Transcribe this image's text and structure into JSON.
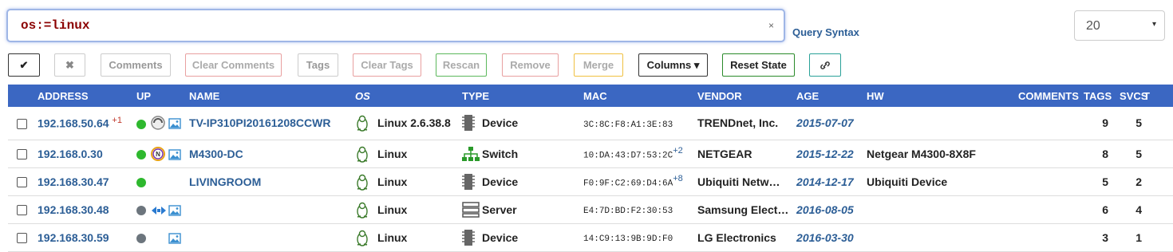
{
  "search": {
    "value": "os:=linux",
    "clear_label": "×"
  },
  "query_syntax_label": "Query Syntax",
  "page_size": {
    "value": "20",
    "caret": "▾"
  },
  "toolbar": {
    "check_label": "✔",
    "x_label": "✖",
    "comments": "Comments",
    "clear_comments": "Clear Comments",
    "tags": "Tags",
    "clear_tags": "Clear Tags",
    "rescan": "Rescan",
    "remove": "Remove",
    "merge": "Merge",
    "columns": "Columns ▾",
    "reset_state": "Reset State",
    "link_label": "🔗"
  },
  "headers": {
    "address": "ADDRESS",
    "up": "UP",
    "name": "NAME",
    "os": "OS",
    "type": "TYPE",
    "mac": "MAC",
    "vendor": "VENDOR",
    "age": "AGE",
    "hw": "HW",
    "comments": "COMMENTS",
    "tags": "TAGS",
    "svcs": "SVCS",
    "t": "T"
  },
  "rows": [
    {
      "address": "192.168.50.64",
      "addr_extra": "+1",
      "up": "#2eb82e",
      "name": "TV-IP310PI20161208CCWR",
      "os": "Linux 2.6.38.8",
      "type": "Device",
      "type_icon": "chip-icon",
      "mac": "3C:8C:F8:A1:3E:83",
      "mac_extra": "",
      "vendor": "TRENDnet, Inc.",
      "age": "2015-07-07",
      "hw": "",
      "tags": "9",
      "svcs": "5"
    },
    {
      "address": "192.168.0.30",
      "addr_extra": "",
      "up": "#2eb82e",
      "name": "M4300-DC",
      "os": "Linux",
      "type": "Switch",
      "type_icon": "network-icon",
      "mac": "10:DA:43:D7:53:2C",
      "mac_extra": "+2",
      "vendor": "NETGEAR",
      "age": "2015-12-22",
      "hw": "Netgear M4300-8X8F",
      "tags": "8",
      "svcs": "5"
    },
    {
      "address": "192.168.30.47",
      "addr_extra": "",
      "up": "#2eb82e",
      "name": "LIVINGROOM",
      "os": "Linux",
      "type": "Device",
      "type_icon": "chip-icon",
      "mac": "F0:9F:C2:69:D4:6A",
      "mac_extra": "+8",
      "vendor": "Ubiquiti Netw…",
      "age": "2014-12-17",
      "hw": "Ubiquiti Device",
      "tags": "5",
      "svcs": "2"
    },
    {
      "address": "192.168.30.48",
      "addr_extra": "",
      "up": "#6c757d",
      "name": "",
      "os": "Linux",
      "type": "Server",
      "type_icon": "server-icon",
      "mac": "E4:7D:BD:F2:30:53",
      "mac_extra": "",
      "vendor": "Samsung Elect…",
      "age": "2016-08-05",
      "hw": "",
      "tags": "6",
      "svcs": "4"
    },
    {
      "address": "192.168.30.59",
      "addr_extra": "",
      "up": "#6c757d",
      "name": "",
      "os": "Linux",
      "type": "Device",
      "type_icon": "chip-icon",
      "mac": "14:C9:13:9B:9D:F0",
      "mac_extra": "",
      "vendor": "LG Electronics",
      "age": "2016-03-30",
      "hw": "",
      "tags": "3",
      "svcs": "1"
    }
  ]
}
